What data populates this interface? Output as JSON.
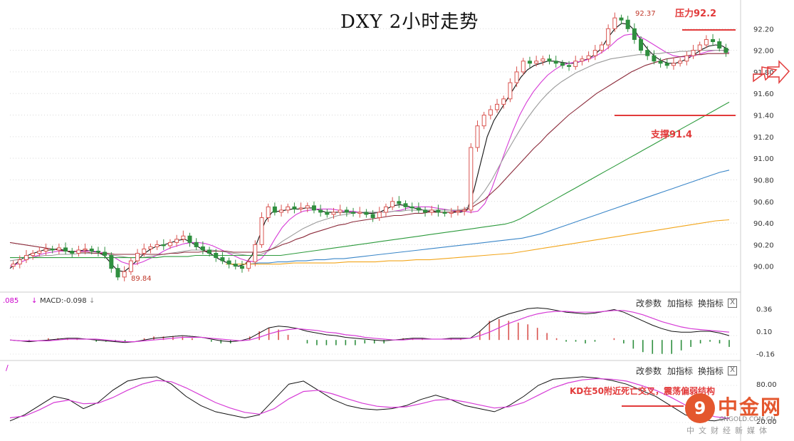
{
  "title": "DXY  2小时走势",
  "annotations": {
    "resistance": "压力92.2",
    "support": "支撑91.4",
    "high_label": "92.37",
    "low_label": "89.84",
    "kd_note": "KD在50附近死亡交叉，震荡偏弱结构"
  },
  "macd_panel": {
    "readout_prefix": ".085",
    "readout_macd": "MACD:-0.098",
    "ticks": [
      "0.36",
      "0.10",
      "-0.16"
    ],
    "tools": [
      "改参数",
      "加指标",
      "换指标"
    ],
    "close": "X"
  },
  "kd_panel": {
    "tools": [
      "改参数",
      "加指标",
      "换指标"
    ],
    "ticks": [
      "80.00",
      "20.00"
    ],
    "close": "X"
  },
  "logo": {
    "mark": "9",
    "name": "中金网",
    "domain": "CNGOLD.COM.CN",
    "tagline": "中文财经新媒体"
  },
  "colors": {
    "up": "#d9534f",
    "down": "#2f8f3f",
    "ma_black": "#111111",
    "ma_magenta": "#d63ad6",
    "ma_gray": "#9a9a9a",
    "ma_maroon": "#8b2a3a",
    "ma_green": "#2c9a3c",
    "ma_blue": "#3a86c8",
    "ma_orange": "#f2a51a",
    "annotation": "#e23a3a"
  },
  "chart_data": [
    {
      "type": "candlestick",
      "title": "DXY  2小时走势",
      "ylim": [
        89.8,
        92.4
      ],
      "y_ticks": [
        "92.20",
        "92.00",
        "91.80",
        "91.60",
        "91.40",
        "91.20",
        "91.00",
        "90.80",
        "90.60",
        "90.40",
        "90.20",
        "90.00"
      ],
      "closes": [
        90.02,
        90.06,
        90.1,
        90.12,
        90.14,
        90.16,
        90.15,
        90.17,
        90.14,
        90.12,
        90.15,
        90.16,
        90.14,
        90.13,
        90.1,
        89.98,
        89.9,
        89.95,
        90.05,
        90.12,
        90.16,
        90.18,
        90.2,
        90.19,
        90.22,
        90.25,
        90.28,
        90.22,
        90.18,
        90.15,
        90.12,
        90.08,
        90.05,
        90.02,
        90.0,
        89.98,
        90.04,
        90.2,
        90.45,
        90.55,
        90.5,
        90.52,
        90.55,
        90.53,
        90.54,
        90.56,
        90.52,
        90.5,
        90.48,
        90.5,
        90.52,
        90.5,
        90.49,
        90.5,
        90.48,
        90.45,
        90.5,
        90.55,
        90.6,
        90.58,
        90.55,
        90.54,
        90.52,
        90.5,
        90.52,
        90.5,
        90.49,
        90.5,
        90.51,
        90.52,
        91.1,
        91.3,
        91.4,
        91.45,
        91.5,
        91.55,
        91.7,
        91.8,
        91.9,
        91.88,
        91.9,
        91.92,
        91.9,
        91.88,
        91.86,
        91.85,
        91.9,
        91.92,
        91.95,
        92.0,
        92.05,
        92.2,
        92.3,
        92.28,
        92.2,
        92.1,
        92.0,
        91.95,
        91.9,
        91.88,
        91.86,
        91.88,
        91.9,
        91.95,
        92.0,
        92.05,
        92.1,
        92.08,
        92.02,
        91.98
      ],
      "ma_series": [
        {
          "name": "MA5",
          "color": "#111111",
          "values": [
            89.98,
            90.03,
            90.08,
            90.11,
            90.13,
            90.15,
            90.15,
            90.16,
            90.15,
            90.13,
            90.14,
            90.15,
            90.14,
            90.13,
            90.1,
            90.03,
            89.96,
            89.95,
            90.0,
            90.06,
            90.12,
            90.16,
            90.19,
            90.2,
            90.22,
            90.24,
            90.25,
            90.22,
            90.18,
            90.14,
            90.11,
            90.07,
            90.04,
            90.02,
            90.0,
            90.02,
            90.1,
            90.26,
            90.42,
            90.5,
            90.51,
            90.52,
            90.53,
            90.53,
            90.54,
            90.54,
            90.52,
            90.5,
            90.5,
            90.5,
            90.5,
            90.5,
            90.5,
            90.49,
            90.49,
            90.5,
            90.53,
            90.56,
            90.57,
            90.56,
            90.54,
            90.53,
            90.51,
            90.51,
            90.5,
            90.5,
            90.5,
            90.5,
            90.52,
            90.7,
            90.95,
            91.2,
            91.35,
            91.45,
            91.55,
            91.65,
            91.75,
            91.82,
            91.86,
            91.88,
            91.9,
            91.9,
            91.89,
            91.88,
            91.88,
            91.9,
            91.92,
            91.96,
            92.02,
            92.12,
            92.2,
            92.25,
            92.24,
            92.18,
            92.08,
            92.0,
            91.94,
            91.9,
            91.88,
            91.88,
            91.9,
            91.93,
            91.97,
            92.01,
            92.04,
            92.05,
            92.04,
            92.0
          ]
        },
        {
          "name": "MA10",
          "color": "#d63ad6",
          "values": [
            90.0,
            90.02,
            90.05,
            90.08,
            90.1,
            90.12,
            90.13,
            90.14,
            90.14,
            90.14,
            90.14,
            90.14,
            90.14,
            90.13,
            90.11,
            90.08,
            90.04,
            90.02,
            90.02,
            90.04,
            90.07,
            90.1,
            90.14,
            90.17,
            90.19,
            90.21,
            90.22,
            90.22,
            90.21,
            90.19,
            90.16,
            90.13,
            90.1,
            90.07,
            90.05,
            90.04,
            90.07,
            90.15,
            90.26,
            90.36,
            90.43,
            90.48,
            90.51,
            90.52,
            90.53,
            90.53,
            90.53,
            90.52,
            90.51,
            90.51,
            90.5,
            90.5,
            90.5,
            90.5,
            90.5,
            90.51,
            90.52,
            90.54,
            90.55,
            90.55,
            90.55,
            90.54,
            90.53,
            90.52,
            90.51,
            90.51,
            90.5,
            90.51,
            90.58,
            90.72,
            90.9,
            91.08,
            91.25,
            91.4,
            91.52,
            91.62,
            91.7,
            91.77,
            91.82,
            91.86,
            91.88,
            91.89,
            91.9,
            91.92,
            91.95,
            91.99,
            92.04,
            92.1,
            92.14,
            92.15,
            92.13,
            92.1,
            92.06,
            92.02,
            91.98,
            91.95,
            91.94,
            91.94,
            91.95,
            91.97,
            91.99,
            92.0,
            92.0,
            91.98
          ]
        },
        {
          "name": "MA20",
          "color": "#9a9a9a",
          "values": [
            90.05,
            90.06,
            90.07,
            90.08,
            90.09,
            90.1,
            90.1,
            90.11,
            90.11,
            90.11,
            90.12,
            90.12,
            90.12,
            90.12,
            90.11,
            90.1,
            90.09,
            90.08,
            90.08,
            90.08,
            90.09,
            90.1,
            90.11,
            90.12,
            90.13,
            90.14,
            90.15,
            90.15,
            90.15,
            90.15,
            90.14,
            90.13,
            90.12,
            90.11,
            90.1,
            90.1,
            90.11,
            90.14,
            90.18,
            90.23,
            90.27,
            90.31,
            90.35,
            90.38,
            90.41,
            90.43,
            90.45,
            90.47,
            90.48,
            90.49,
            90.5,
            90.5,
            90.5,
            90.5,
            90.5,
            90.51,
            90.51,
            90.52,
            90.52,
            90.52,
            90.52,
            90.52,
            90.52,
            90.52,
            90.52,
            90.53,
            90.56,
            90.62,
            90.7,
            90.8,
            90.92,
            91.04,
            91.15,
            91.26,
            91.36,
            91.45,
            91.53,
            91.6,
            91.66,
            91.71,
            91.75,
            91.79,
            91.82,
            91.85,
            91.88,
            91.9,
            91.92,
            91.93,
            91.94,
            91.95,
            91.96,
            91.96,
            91.97,
            91.97,
            91.98,
            91.98,
            91.99,
            91.99,
            92.0,
            92.0,
            92.0,
            92.0,
            92.0,
            92.0
          ]
        },
        {
          "name": "MA30",
          "color": "#8b2a3a",
          "values": [
            90.22,
            90.21,
            90.2,
            90.19,
            90.18,
            90.17,
            90.16,
            90.15,
            90.14,
            90.14,
            90.13,
            90.13,
            90.12,
            90.12,
            90.12,
            90.11,
            90.11,
            90.11,
            90.11,
            90.11,
            90.11,
            90.11,
            90.11,
            90.12,
            90.12,
            90.13,
            90.13,
            90.13,
            90.14,
            90.14,
            90.14,
            90.14,
            90.13,
            90.13,
            90.13,
            90.13,
            90.13,
            90.15,
            90.17,
            90.2,
            90.22,
            90.25,
            90.27,
            90.3,
            90.32,
            90.34,
            90.36,
            90.38,
            90.39,
            90.41,
            90.42,
            90.43,
            90.44,
            90.45,
            90.46,
            90.47,
            90.47,
            90.48,
            90.49,
            90.49,
            90.5,
            90.5,
            90.5,
            90.5,
            90.51,
            90.52,
            90.54,
            90.58,
            90.62,
            90.68,
            90.74,
            90.81,
            90.88,
            90.95,
            91.02,
            91.09,
            91.15,
            91.22,
            91.28,
            91.34,
            91.4,
            91.45,
            91.5,
            91.55,
            91.6,
            91.64,
            91.68,
            91.72,
            91.76,
            91.8,
            91.83,
            91.86,
            91.88,
            91.9,
            91.92,
            91.93,
            91.94,
            91.95,
            91.96,
            91.96,
            91.97,
            91.97,
            91.97,
            91.97
          ]
        },
        {
          "name": "MA60",
          "color": "#2c9a3c",
          "values": [
            90.08,
            90.08,
            90.08,
            90.08,
            90.08,
            90.08,
            90.08,
            90.08,
            90.08,
            90.08,
            90.08,
            90.08,
            90.08,
            90.08,
            90.08,
            90.08,
            90.08,
            90.08,
            90.08,
            90.08,
            90.09,
            90.09,
            90.09,
            90.09,
            90.1,
            90.1,
            90.1,
            90.1,
            90.1,
            90.1,
            90.1,
            90.1,
            90.1,
            90.1,
            90.1,
            90.1,
            90.11,
            90.12,
            90.13,
            90.14,
            90.15,
            90.16,
            90.17,
            90.18,
            90.19,
            90.2,
            90.21,
            90.22,
            90.23,
            90.24,
            90.25,
            90.26,
            90.27,
            90.28,
            90.29,
            90.3,
            90.31,
            90.32,
            90.33,
            90.34,
            90.35,
            90.36,
            90.37,
            90.38,
            90.39,
            90.41,
            90.44,
            90.48,
            90.52,
            90.56,
            90.6,
            90.64,
            90.68,
            90.72,
            90.76,
            90.8,
            90.84,
            90.88,
            90.92,
            90.96,
            91.0,
            91.04,
            91.08,
            91.12,
            91.16,
            91.2,
            91.24,
            91.28,
            91.32,
            91.36,
            91.4,
            91.44,
            91.48,
            91.52
          ]
        },
        {
          "name": "MA120",
          "color": "#3a86c8",
          "values": [
            90.02,
            90.02,
            90.03,
            90.03,
            90.04,
            90.04,
            90.05,
            90.05,
            90.06,
            90.06,
            90.07,
            90.07,
            90.08,
            90.09,
            90.1,
            90.11,
            90.12,
            90.13,
            90.14,
            90.15,
            90.16,
            90.17,
            90.18,
            90.19,
            90.2,
            90.21,
            90.22,
            90.23,
            90.24,
            90.25,
            90.26,
            90.28,
            90.3,
            90.33,
            90.36,
            90.39,
            90.42,
            90.45,
            90.48,
            90.51,
            90.54,
            90.57,
            90.6,
            90.63,
            90.66,
            90.69,
            90.72,
            90.75,
            90.78,
            90.81,
            90.84,
            90.87,
            90.89
          ]
        },
        {
          "name": "MA250",
          "color": "#f2a51a",
          "values": [
            90.02,
            90.02,
            90.02,
            90.02,
            90.02,
            90.03,
            90.03,
            90.03,
            90.03,
            90.04,
            90.04,
            90.04,
            90.05,
            90.05,
            90.06,
            90.06,
            90.07,
            90.08,
            90.09,
            90.1,
            90.11,
            90.12,
            90.14,
            90.16,
            90.18,
            90.2,
            90.22,
            90.24,
            90.26,
            90.28,
            90.3,
            90.32,
            90.34,
            90.36,
            90.38,
            90.4,
            90.42,
            90.43
          ]
        }
      ]
    },
    {
      "type": "bar",
      "title": "MACD",
      "ylim": [
        -0.22,
        0.42
      ],
      "dif": [
        0.0,
        -0.01,
        -0.02,
        -0.01,
        0.0,
        0.01,
        0.02,
        0.02,
        0.01,
        0.0,
        -0.01,
        -0.02,
        -0.03,
        -0.02,
        0.0,
        0.02,
        0.03,
        0.04,
        0.05,
        0.04,
        0.03,
        0.01,
        -0.01,
        -0.02,
        -0.01,
        0.02,
        0.08,
        0.14,
        0.16,
        0.15,
        0.13,
        0.1,
        0.08,
        0.06,
        0.05,
        0.03,
        0.02,
        0.01,
        0.0,
        -0.01,
        0.0,
        0.01,
        0.02,
        0.02,
        0.01,
        0.01,
        0.02,
        0.02,
        0.02,
        0.1,
        0.2,
        0.26,
        0.3,
        0.33,
        0.36,
        0.37,
        0.36,
        0.34,
        0.32,
        0.31,
        0.3,
        0.31,
        0.33,
        0.35,
        0.32,
        0.27,
        0.22,
        0.17,
        0.13,
        0.1,
        0.09,
        0.09,
        0.1,
        0.1,
        0.08,
        0.05
      ],
      "dea": [
        0.0,
        -0.01,
        -0.01,
        -0.01,
        -0.01,
        0.0,
        0.01,
        0.01,
        0.01,
        0.01,
        0.0,
        -0.01,
        -0.02,
        -0.02,
        -0.01,
        0.0,
        0.01,
        0.02,
        0.03,
        0.03,
        0.03,
        0.02,
        0.01,
        0.0,
        -0.01,
        0.0,
        0.03,
        0.07,
        0.1,
        0.12,
        0.13,
        0.12,
        0.11,
        0.09,
        0.08,
        0.06,
        0.05,
        0.03,
        0.02,
        0.01,
        0.0,
        0.0,
        0.01,
        0.01,
        0.01,
        0.01,
        0.01,
        0.01,
        0.02,
        0.05,
        0.09,
        0.14,
        0.19,
        0.23,
        0.27,
        0.3,
        0.32,
        0.33,
        0.33,
        0.32,
        0.32,
        0.32,
        0.33,
        0.34,
        0.34,
        0.32,
        0.29,
        0.25,
        0.21,
        0.18,
        0.15,
        0.13,
        0.12,
        0.11,
        0.1,
        0.09
      ],
      "ticks": [
        0.36,
        0.1,
        -0.16
      ]
    },
    {
      "type": "line",
      "title": "KD",
      "ylim": [
        0,
        100
      ],
      "k": [
        20,
        30,
        45,
        60,
        55,
        40,
        50,
        70,
        85,
        90,
        92,
        80,
        60,
        45,
        35,
        30,
        25,
        30,
        55,
        80,
        85,
        70,
        55,
        45,
        40,
        38,
        40,
        45,
        55,
        62,
        55,
        45,
        40,
        35,
        45,
        60,
        78,
        88,
        90,
        92,
        90,
        86,
        80,
        70,
        60,
        45,
        30,
        22,
        20,
        25
      ],
      "d": [
        25,
        28,
        38,
        50,
        54,
        48,
        49,
        58,
        70,
        80,
        86,
        84,
        74,
        62,
        50,
        41,
        34,
        31,
        40,
        56,
        68,
        70,
        64,
        56,
        49,
        44,
        42,
        43,
        48,
        54,
        55,
        51,
        46,
        41,
        43,
        50,
        62,
        74,
        82,
        87,
        89,
        88,
        85,
        78,
        70,
        59,
        46,
        35,
        27,
        24
      ],
      "ticks": [
        80,
        20
      ]
    }
  ]
}
